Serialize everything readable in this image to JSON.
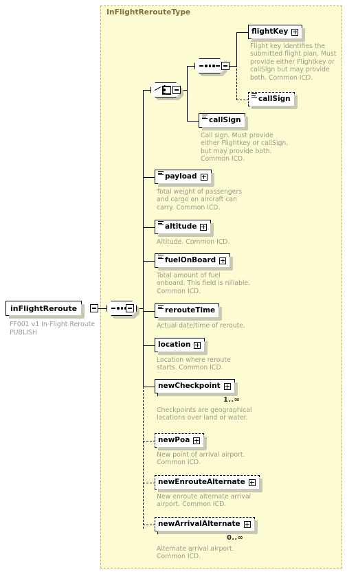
{
  "diagram": {
    "type_panel_title": "InFlightRerouteType",
    "colors": {
      "panel_background": "#fcfbd2",
      "panel_border": "#c9ae4e",
      "panel_title_text": "#7e6e3a",
      "doc_text": "#9a9a8c",
      "node_border": "#000000",
      "node_fill": "#ffffff",
      "shadow": "#c8c8b4"
    }
  },
  "root": {
    "name": "inFlightReroute",
    "documentation": "FF001 v1 In-Flight Reroute\nPUBLISH",
    "expander": "minus"
  },
  "compositors": {
    "root_sequence": {
      "kind": "sequence",
      "expander": "minus"
    },
    "choice": {
      "kind": "choice",
      "expander": "minus"
    },
    "inner_sequence": {
      "kind": "sequence",
      "expander": "minus"
    }
  },
  "nodes": [
    {
      "name": "flightKey",
      "documentation": "Flight key identifies the\nsubmitted flight plan.  Must\nprovide either Flightkey or\ncallSign but may provide\nboth. Common ICD.",
      "optional": false,
      "has_element_icon": false,
      "has_expander": true,
      "repeating": false,
      "cardinality": ""
    },
    {
      "name": "callSign",
      "documentation": "",
      "optional": true,
      "has_element_icon": true,
      "has_expander": false,
      "repeating": false,
      "cardinality": ""
    },
    {
      "name": "callSign",
      "documentation": "Call sign.  Must provide\neither Flightkey or callSign,\nbut may provide both.\nCommon ICD.",
      "optional": false,
      "has_element_icon": true,
      "has_expander": false,
      "repeating": false,
      "cardinality": ""
    },
    {
      "name": "payload",
      "documentation": "Total weight of passengers\nand cargo an aircraft can\ncarry. Common ICD.",
      "optional": false,
      "has_element_icon": true,
      "has_expander": true,
      "repeating": false,
      "cardinality": ""
    },
    {
      "name": "altitude",
      "documentation": "Altitude. Common ICD.",
      "optional": false,
      "has_element_icon": true,
      "has_expander": true,
      "repeating": false,
      "cardinality": ""
    },
    {
      "name": "fuelOnBoard",
      "documentation": "Total amount of fuel\nonboard. This field is nillable.\nCommon ICD.",
      "optional": false,
      "has_element_icon": true,
      "has_expander": true,
      "repeating": false,
      "cardinality": ""
    },
    {
      "name": "rerouteTime",
      "documentation": "Actual date/time of reroute.",
      "optional": false,
      "has_element_icon": true,
      "has_expander": false,
      "repeating": false,
      "cardinality": ""
    },
    {
      "name": "location",
      "documentation": "Location where reroute\nstarts. Common ICD.",
      "optional": false,
      "has_element_icon": false,
      "has_expander": true,
      "repeating": false,
      "cardinality": ""
    },
    {
      "name": "newCheckpoint",
      "documentation": "Checkpoints are geographical\nlocations over land or water.",
      "optional": false,
      "has_element_icon": false,
      "has_expander": true,
      "repeating": true,
      "cardinality": "1..∞"
    },
    {
      "name": "newPoa",
      "documentation": "New point of arrival airport.\nCommon ICD.",
      "optional": true,
      "has_element_icon": false,
      "has_expander": true,
      "repeating": false,
      "cardinality": ""
    },
    {
      "name": "newEnrouteAlternate",
      "documentation": "New enroute alternate arrival\nairport. Common ICD.",
      "optional": true,
      "has_element_icon": false,
      "has_expander": true,
      "repeating": false,
      "cardinality": ""
    },
    {
      "name": "newArrivalAlternate",
      "documentation": "Alternate arrival airport.\nCommon ICD.",
      "optional": true,
      "has_element_icon": false,
      "has_expander": true,
      "repeating": true,
      "cardinality": "0..∞"
    }
  ]
}
